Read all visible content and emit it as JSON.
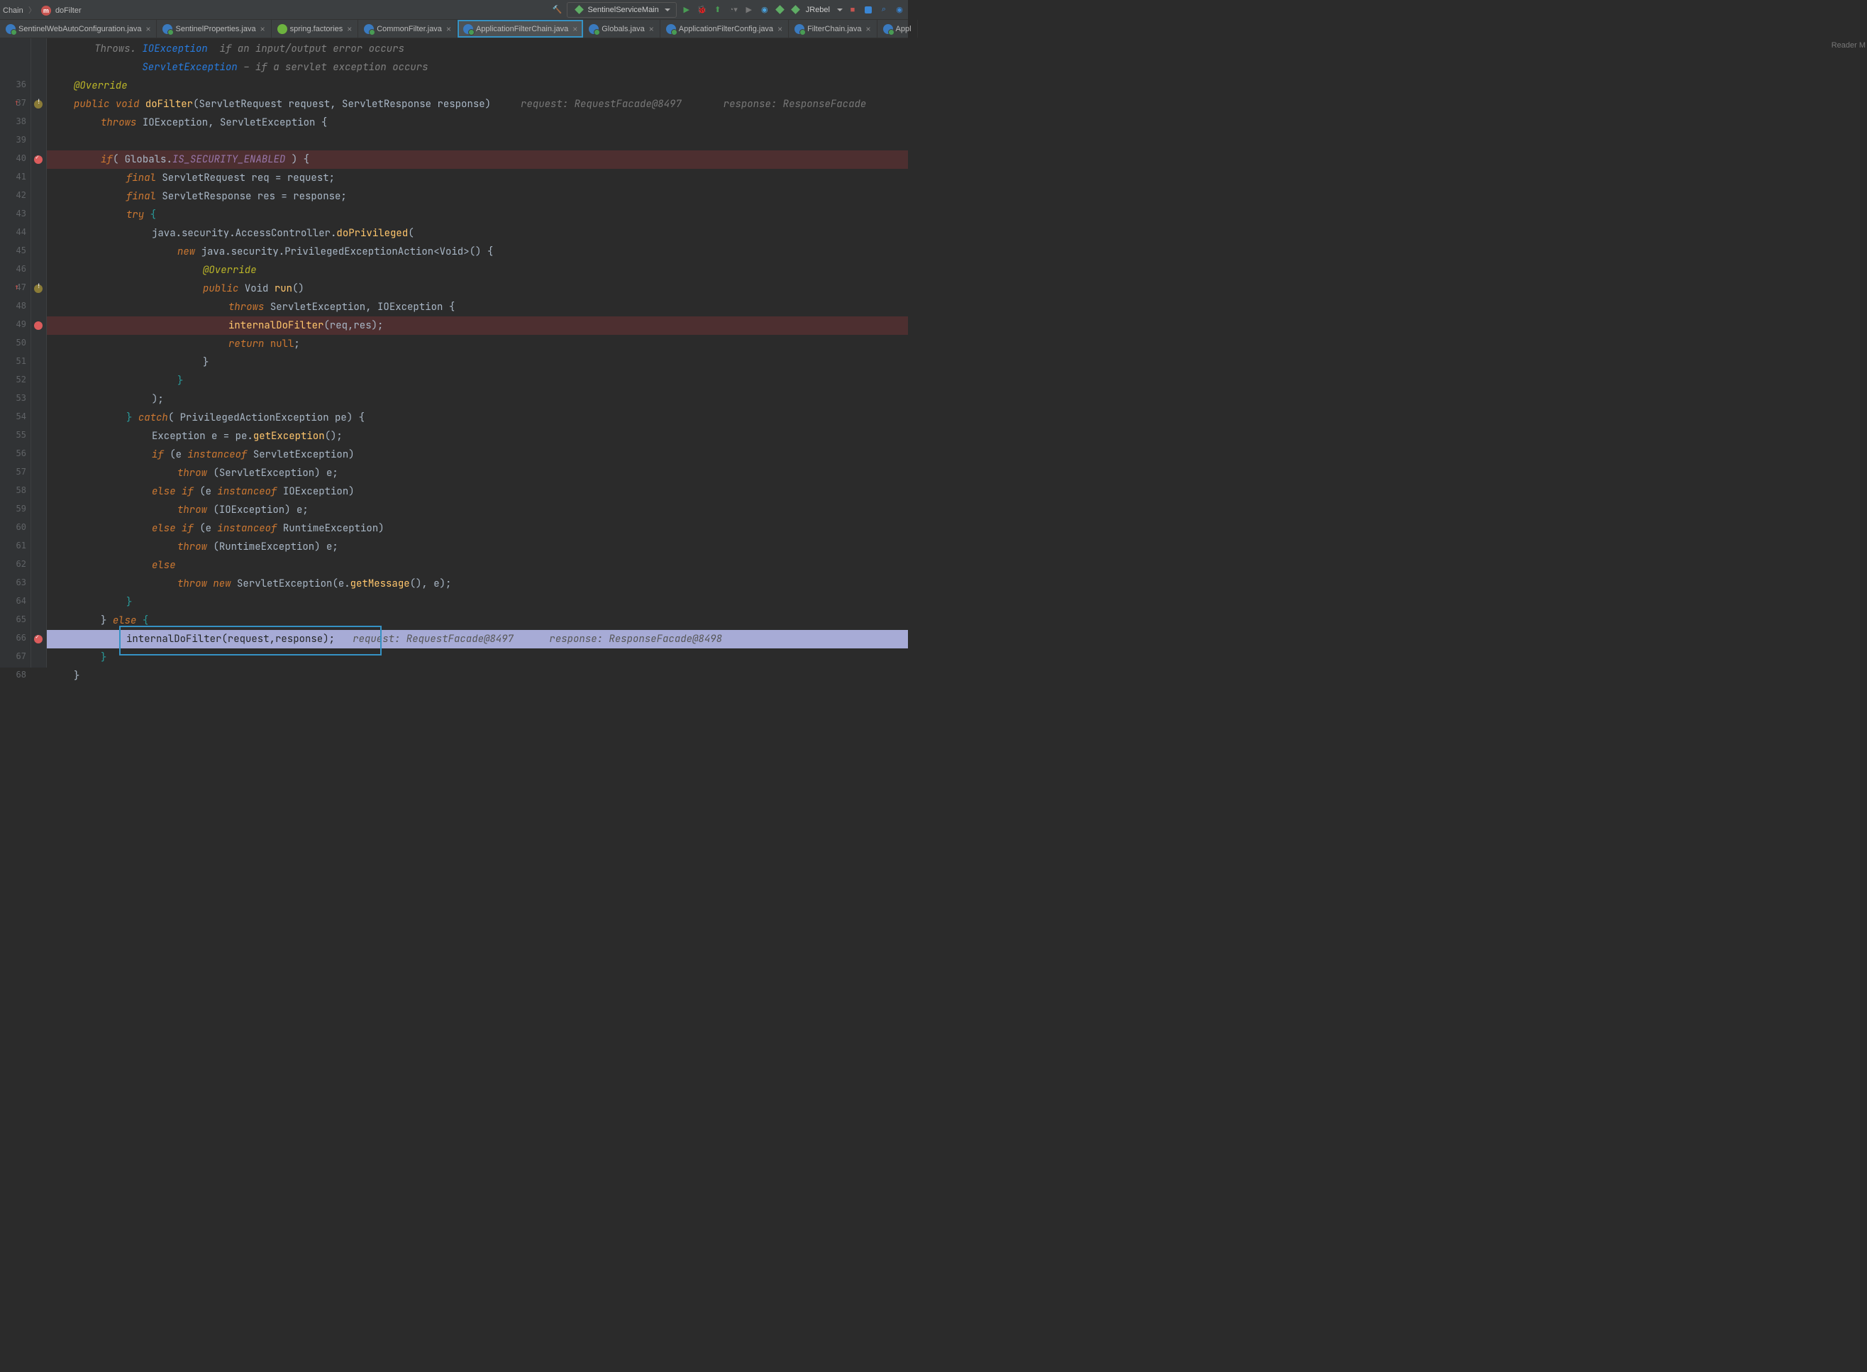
{
  "breadcrumb": {
    "part1": "Chain",
    "part2": "doFilter"
  },
  "run_config": {
    "label": "SentinelServiceMain"
  },
  "jrebel": {
    "label": "JRebel"
  },
  "reader_mode": "Reader M",
  "tabs": [
    {
      "label": "SentinelWebAutoConfiguration.java",
      "icon": "loaded"
    },
    {
      "label": "SentinelProperties.java",
      "icon": "loaded"
    },
    {
      "label": "spring.factories",
      "icon": "spring"
    },
    {
      "label": "CommonFilter.java",
      "icon": "loaded"
    },
    {
      "label": "ApplicationFilterChain.java",
      "icon": "loaded",
      "active": true
    },
    {
      "label": "Globals.java",
      "icon": "loaded"
    },
    {
      "label": "ApplicationFilterConfig.java",
      "icon": "loaded"
    },
    {
      "label": "FilterChain.java",
      "icon": "loaded"
    },
    {
      "label": "Appl",
      "icon": "loaded",
      "cut": true
    }
  ],
  "line_numbers": {
    "first": 36,
    "last": 68,
    "hidden_first_two": true
  },
  "javadoc": {
    "link": "ServletException",
    "text": " – if a servlet exception occurs"
  },
  "code": {
    "override": "@Override",
    "sig1": {
      "pub": "public",
      "void": "void",
      "name": "doFilter",
      "p1t": "ServletRequest",
      "p1n": "request",
      "p2t": "ServletResponse",
      "p2n": "response"
    },
    "inlay_req": "request: RequestFacade@8497",
    "inlay_res": "response: ResponseFacade",
    "throws": {
      "kw": "throws",
      "t1": "IOException",
      "t2": "ServletException"
    },
    "if_line": {
      "if": "if",
      "cls": "Globals",
      "field": "IS_SECURITY_ENABLED"
    },
    "l41": {
      "f": "final",
      "t": "ServletRequest",
      "n": "req",
      "eq": "=",
      "v": "request"
    },
    "l42": {
      "f": "final",
      "t": "ServletResponse",
      "n": "res",
      "eq": "=",
      "v": "response"
    },
    "l43": {
      "try": "try"
    },
    "l44": {
      "a": "java",
      "b": "security",
      "c": "AccessController",
      "m": "doPrivileged"
    },
    "l45": {
      "new": "new",
      "a": "java",
      "b": "security",
      "c": "PrivilegedExceptionAction",
      "g": "Void"
    },
    "l46": "@Override",
    "l47": {
      "pub": "public",
      "t": "Void",
      "m": "run"
    },
    "l48": {
      "kw": "throws",
      "t1": "ServletException",
      "t2": "IOException"
    },
    "l49": {
      "m": "internalDoFilter",
      "a1": "req",
      "a2": "res"
    },
    "l50": {
      "ret": "return",
      "nul": "null"
    },
    "l54": {
      "c": "catch",
      "t": "PrivilegedActionException",
      "n": "pe"
    },
    "l55": {
      "t": "Exception",
      "n": "e",
      "pe": "pe",
      "m": "getException"
    },
    "l56": {
      "if": "if",
      "e": "e",
      "io": "instanceof",
      "t": "ServletException"
    },
    "l57": {
      "th": "throw",
      "t": "ServletException",
      "e": "e"
    },
    "l58": {
      "el": "else if",
      "e": "e",
      "io": "instanceof",
      "t": "IOException"
    },
    "l59": {
      "th": "throw",
      "t": "IOException",
      "e": "e"
    },
    "l60": {
      "el": "else if",
      "e": "e",
      "io": "instanceof",
      "t": "RuntimeException"
    },
    "l61": {
      "th": "throw",
      "t": "RuntimeException",
      "e": "e"
    },
    "l62": {
      "el": "else"
    },
    "l63": {
      "th": "throw",
      "new": "new",
      "t": "ServletException",
      "e": "e",
      "m": "getMessage"
    },
    "l65": {
      "el": "else"
    },
    "l66": {
      "m": "internalDoFilter",
      "a1": "request",
      "a2": "response"
    },
    "l66_inlay1": "request: RequestFacade@8497",
    "l66_inlay2": "response: ResponseFacade@8498"
  },
  "breakpoints": [
    40,
    49,
    66
  ],
  "warn_lines": [
    37,
    47
  ]
}
